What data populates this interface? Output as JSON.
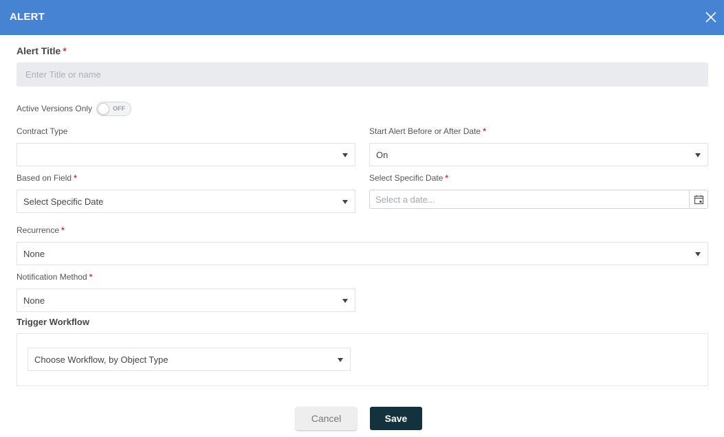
{
  "dialog": {
    "title": "ALERT",
    "close_icon": "close-icon"
  },
  "form": {
    "alert_title": {
      "label": "Alert Title",
      "required": "*",
      "value": "",
      "placeholder": "Enter Title or name"
    },
    "active_versions": {
      "label": "Active Versions Only",
      "toggle_state": "OFF"
    },
    "contract_type": {
      "label": "Contract Type",
      "value": ""
    },
    "start_alert": {
      "label": "Start Alert Before or After Date",
      "required": "*",
      "value": "On"
    },
    "based_on_field": {
      "label": "Based on Field",
      "required": "*",
      "value": "Select Specific Date"
    },
    "specific_date": {
      "label": "Select Specific Date",
      "required": "*",
      "value": "",
      "placeholder": "Select a date...",
      "icon": "calendar-icon"
    },
    "recurrence": {
      "label": "Recurrence",
      "required": "*",
      "value": "None"
    },
    "notification_method": {
      "label": "Notification Method",
      "required": "*",
      "value": "None"
    },
    "trigger_workflow": {
      "label": "Trigger Workflow",
      "value": "Choose Workflow, by Object Type"
    }
  },
  "actions": {
    "cancel_label": "Cancel",
    "save_label": "Save"
  },
  "colors": {
    "header": "#4683d3",
    "required": "#d9363e",
    "save_button": "#14323d"
  }
}
